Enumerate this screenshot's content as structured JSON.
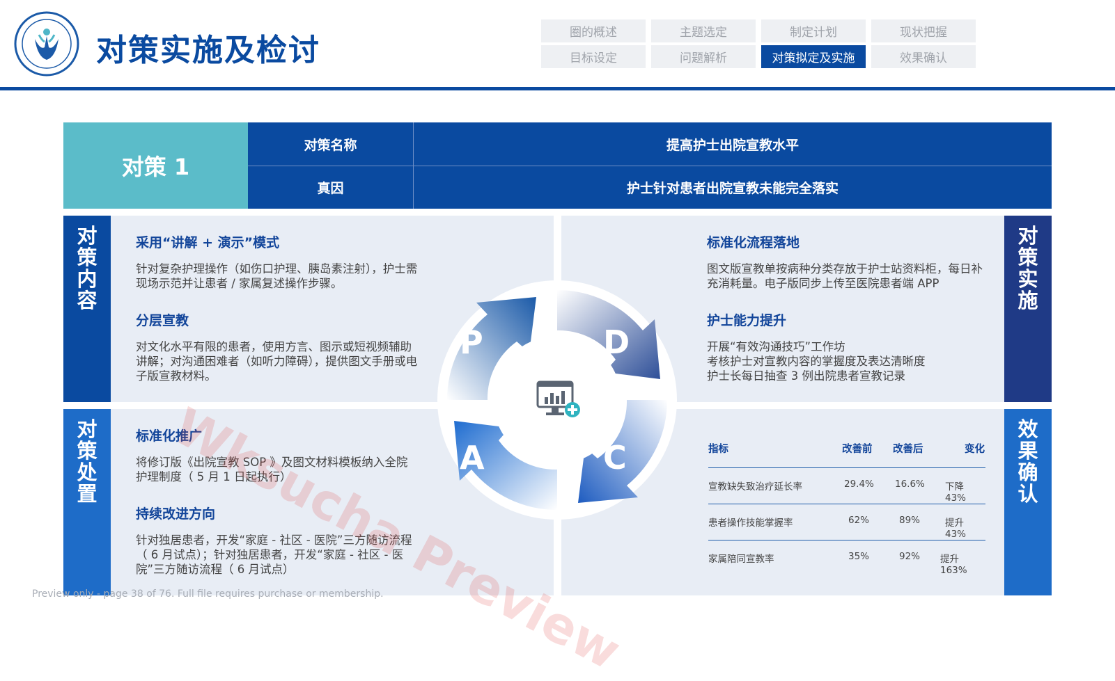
{
  "header": {
    "title": "对策实施及检讨",
    "nav": [
      "圈的概述",
      "主题选定",
      "制定计划",
      "现状把握",
      "目标设定",
      "问题解析",
      "对策拟定及实施",
      "效果确认"
    ]
  },
  "countermeasure": {
    "label": "对策 1",
    "name_label": "对策名称",
    "name_value": "提高护士出院宣教水平",
    "cause_label": "真因",
    "cause_value": "护士针对患者出院宣教未能完全落实"
  },
  "side": {
    "content": "对策内容",
    "implement": "对策实施",
    "handle": "对策处置",
    "effect": "效果确认"
  },
  "blocks": {
    "b1_title": "采用“讲解 + 演示”模式",
    "b1_text": "针对复杂护理操作（如伤口护理、胰岛素注射），护士需现场示范并让患者 / 家属复述操作步骤。",
    "b2_title": "分层宣教",
    "b2_text": "对文化水平有限的患者，使用方言、图示或短视频辅助讲解；对沟通困难者（如听力障碍），提供图文手册或电子版宣教材料。",
    "b3_title": "标准化流程落地",
    "b3_text": "图文版宣教单按病种分类存放于护士站资料柜，每日补充消耗量。电子版同步上传至医院患者端 APP",
    "b4_title": "护士能力提升",
    "b4_l1": "开展“有效沟通技巧”工作坊",
    "b4_l2": "考核护士对宣教内容的掌握度及表达清晰度",
    "b4_l3": "护士长每日抽查 3 例出院患者宣教记录",
    "b5_title": "标准化推广",
    "b5_text": "将修订版《出院宣教 SOP 》及图文材料模板纳入全院护理制度（ 5 月 1 日起执行）",
    "b6_title": "持续改进方向",
    "b6_text": "针对独居患者，开发“家庭 - 社区 - 医院”三方随访流程（ 6 月试点）；针对独居患者，开发“家庭 - 社区 - 医院”三方随访流程（ 6 月试点）"
  },
  "pdca": {
    "p": "P",
    "d": "D",
    "c": "C",
    "a": "A",
    "center_icon": "monitor-chart-plus-icon"
  },
  "effect_table": {
    "headers": [
      "指标",
      "改善前",
      "改善后",
      "变化"
    ],
    "rows": [
      [
        "宣教缺失致治疗延长率",
        "29.4%",
        "16.6%",
        "下降 43%"
      ],
      [
        "患者操作技能掌握率",
        "62%",
        "89%",
        "提升 43%"
      ],
      [
        "家属陪同宣教率",
        "35%",
        "92%",
        "提升 163%"
      ]
    ]
  },
  "watermark": "Wksucha Preview",
  "footer": "Preview only - page 38 of 76. Full file requires purchase or membership.",
  "colors": {
    "primary": "#0a4aa0",
    "teal": "#5bbcc9",
    "panel": "#e8edf5",
    "side_dark": "#1f3a86",
    "side_blue": "#1e6cc8"
  }
}
